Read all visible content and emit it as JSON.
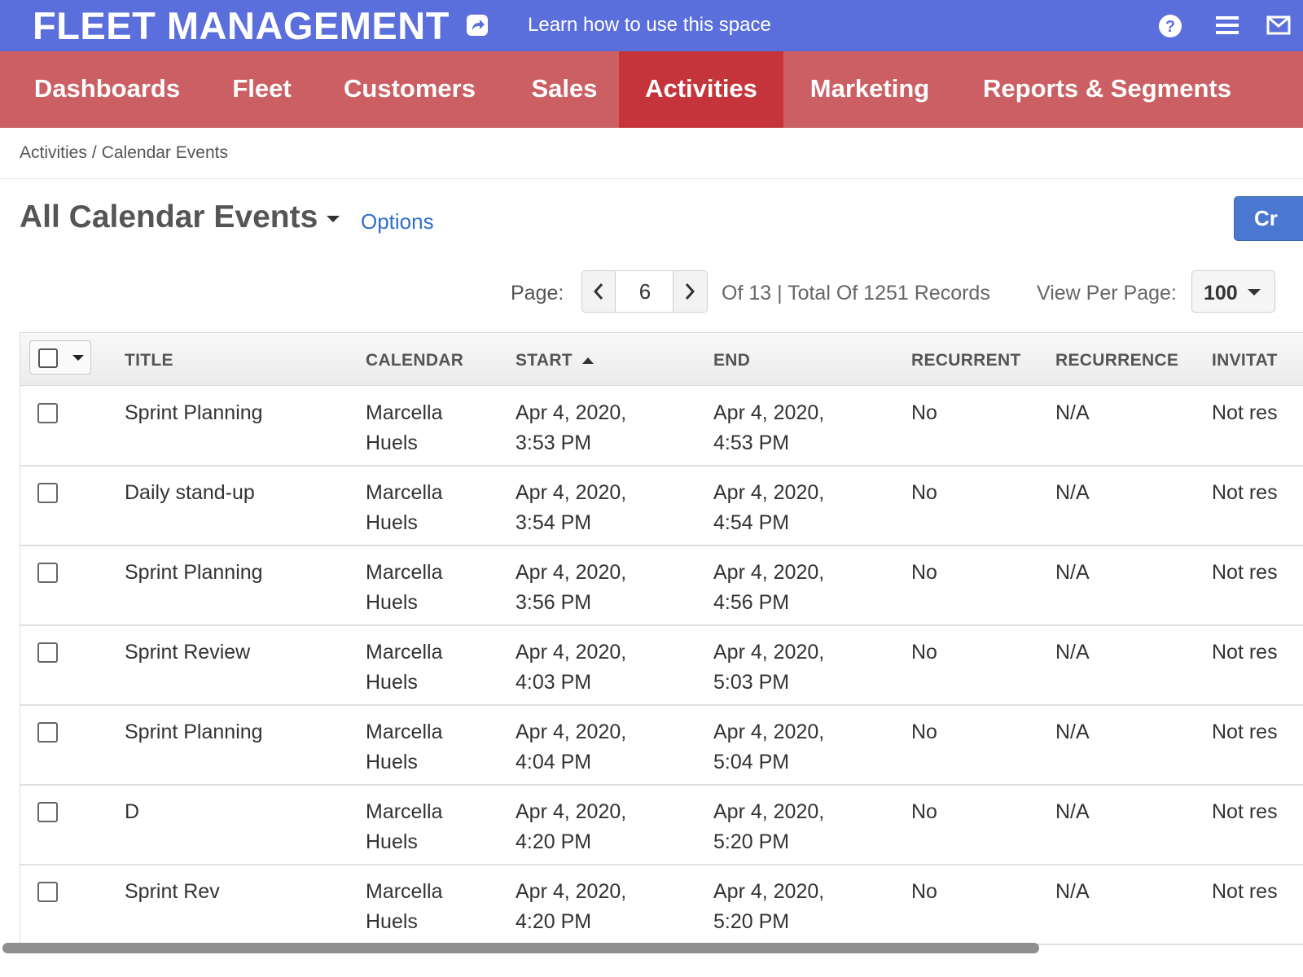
{
  "app": {
    "title": "FLEET MANAGEMENT",
    "learn_link": "Learn how to use this space",
    "icons": [
      "share-icon",
      "help-icon",
      "menu-icon",
      "mail-icon"
    ]
  },
  "nav": {
    "items": [
      {
        "label": "Dashboards"
      },
      {
        "label": "Fleet"
      },
      {
        "label": "Customers"
      },
      {
        "label": "Sales"
      },
      {
        "label": "Activities",
        "active": true
      },
      {
        "label": "Marketing"
      },
      {
        "label": "Reports & Segments"
      }
    ]
  },
  "breadcrumb": {
    "items": [
      "Activities",
      "/",
      "Calendar Events"
    ]
  },
  "page": {
    "title": "All Calendar Events",
    "options_label": "Options",
    "create_label": "Cr"
  },
  "pagination": {
    "page_label": "Page:",
    "current_page": "6",
    "records_text": "Of 13 | Total Of 1251 Records",
    "per_page_label": "View Per Page:",
    "per_page_value": "100"
  },
  "table": {
    "columns": [
      "TITLE",
      "CALENDAR",
      "START",
      "END",
      "RECURRENT",
      "RECURRENCE",
      "INVITAT"
    ],
    "sort_column": "START",
    "sort_direction": "ascending",
    "rows": [
      {
        "title": "Sprint Planning",
        "calendar": [
          "Marcella",
          "Huels"
        ],
        "start": [
          "Apr 4, 2020,",
          "3:53 PM"
        ],
        "end": [
          "Apr 4, 2020,",
          "4:53 PM"
        ],
        "recurrent": "No",
        "recurrence": "N/A",
        "invitation": "Not res"
      },
      {
        "title": "Daily stand-up",
        "calendar": [
          "Marcella",
          "Huels"
        ],
        "start": [
          "Apr 4, 2020,",
          "3:54 PM"
        ],
        "end": [
          "Apr 4, 2020,",
          "4:54 PM"
        ],
        "recurrent": "No",
        "recurrence": "N/A",
        "invitation": "Not res"
      },
      {
        "title": "Sprint Planning",
        "calendar": [
          "Marcella",
          "Huels"
        ],
        "start": [
          "Apr 4, 2020,",
          "3:56 PM"
        ],
        "end": [
          "Apr 4, 2020,",
          "4:56 PM"
        ],
        "recurrent": "No",
        "recurrence": "N/A",
        "invitation": "Not res"
      },
      {
        "title": "Sprint Review",
        "calendar": [
          "Marcella",
          "Huels"
        ],
        "start": [
          "Apr 4, 2020,",
          "4:03 PM"
        ],
        "end": [
          "Apr 4, 2020,",
          "5:03 PM"
        ],
        "recurrent": "No",
        "recurrence": "N/A",
        "invitation": "Not res"
      },
      {
        "title": "Sprint Planning",
        "calendar": [
          "Marcella",
          "Huels"
        ],
        "start": [
          "Apr 4, 2020,",
          "4:04 PM"
        ],
        "end": [
          "Apr 4, 2020,",
          "5:04 PM"
        ],
        "recurrent": "No",
        "recurrence": "N/A",
        "invitation": "Not res"
      },
      {
        "title": "D",
        "calendar": [
          "Marcella",
          "Huels"
        ],
        "start": [
          "Apr 4, 2020,",
          "4:20 PM"
        ],
        "end": [
          "Apr 4, 2020,",
          "5:20 PM"
        ],
        "recurrent": "No",
        "recurrence": "N/A",
        "invitation": "Not res"
      },
      {
        "title": "Sprint Rev",
        "calendar": [
          "Marcella",
          "Huels"
        ],
        "start": [
          "Apr 4, 2020,",
          "4:20 PM"
        ],
        "end": [
          "Apr 4, 2020,",
          "5:20 PM"
        ],
        "recurrent": "No",
        "recurrence": "N/A",
        "invitation": "Not res"
      }
    ]
  },
  "colors": {
    "topbar": "#5b6fdc",
    "navbar": "#cb5f63",
    "nav_active": "#c4343a",
    "link": "#2f6fcb",
    "primary_button": "#4a78d1"
  }
}
